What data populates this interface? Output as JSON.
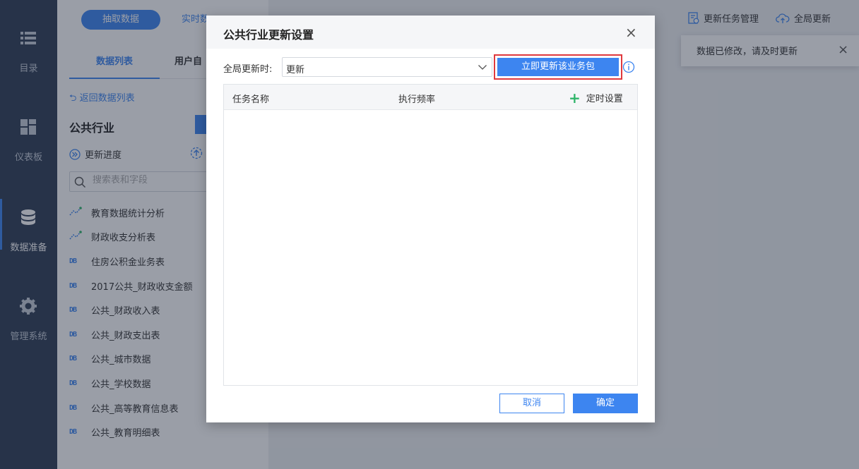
{
  "leftnav": {
    "items": [
      {
        "label": "目录",
        "icon": "list-icon"
      },
      {
        "label": "仪表板",
        "icon": "dashboard-icon"
      },
      {
        "label": "数据准备",
        "icon": "database-icon",
        "active": true
      },
      {
        "label": "管理系统",
        "icon": "gear-icon"
      }
    ]
  },
  "midpanel": {
    "segments": [
      "抽取数据",
      "实时数"
    ],
    "tabs": [
      "数据列表",
      "用户自"
    ],
    "back_label": "返回数据列表",
    "package_title": "公共行业",
    "progress_label": "更新进度",
    "search_placeholder": "搜索表和字段",
    "tables": [
      {
        "name": "教育数据统计分析",
        "type": "analysis"
      },
      {
        "name": "财政收支分析表",
        "type": "analysis"
      },
      {
        "name": "住房公积金业务表",
        "type": "DB"
      },
      {
        "name": "2017公共_财政收支金额",
        "type": "DB"
      },
      {
        "name": "公共_财政收入表",
        "type": "DB"
      },
      {
        "name": "公共_财政支出表",
        "type": "DB"
      },
      {
        "name": "公共_城市数据",
        "type": "DB"
      },
      {
        "name": "公共_学校数据",
        "type": "DB"
      },
      {
        "name": "公共_高等教育信息表",
        "type": "DB"
      },
      {
        "name": "公共_教育明细表",
        "type": "DB"
      }
    ]
  },
  "toolbar": {
    "items": [
      "更新任务管理",
      "全局更新"
    ]
  },
  "toast": {
    "message": "数据已修改，请及时更新"
  },
  "dialog": {
    "title": "公共行业更新设置",
    "global_update_label": "全局更新时:",
    "global_update_value": "更新",
    "update_now_button": "立即更新该业务包",
    "columns": [
      "任务名称",
      "执行频率"
    ],
    "timer_setting": "定时设置",
    "cancel": "取消",
    "ok": "确定"
  },
  "colors": {
    "primary": "#3d85f0",
    "nav_bg": "#2e3d55",
    "highlight_border": "#e0393e",
    "add_green": "#2fb56a"
  }
}
